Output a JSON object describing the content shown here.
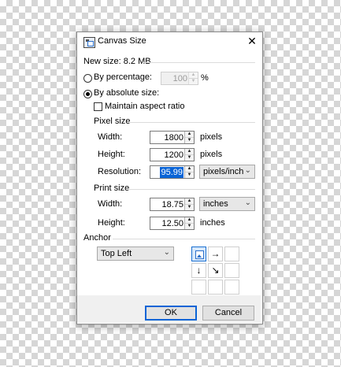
{
  "dialog": {
    "title": "Canvas Size",
    "close_glyph": "✕",
    "new_size": "New size: 8.2 MB",
    "by_percentage_label": "By percentage:",
    "percentage_value": "100",
    "percent_unit": "%",
    "by_absolute_label": "By absolute size:",
    "maintain_aspect_label": "Maintain aspect ratio",
    "pixel_size": {
      "header": "Pixel size",
      "width_label": "Width:",
      "width_value": "1800",
      "width_unit": "pixels",
      "height_label": "Height:",
      "height_value": "1200",
      "height_unit": "pixels",
      "resolution_label": "Resolution:",
      "resolution_value": "95.99",
      "resolution_unit": "pixels/inch"
    },
    "print_size": {
      "header": "Print size",
      "width_label": "Width:",
      "width_value": "18.75",
      "width_unit": "inches",
      "height_label": "Height:",
      "height_value": "12.50",
      "height_unit": "inches"
    },
    "anchor": {
      "header": "Anchor",
      "selected": "Top Left",
      "grid": [
        "",
        "→",
        "",
        "↓",
        "↘",
        "",
        "",
        "",
        ""
      ]
    },
    "ok_label": "OK",
    "cancel_label": "Cancel",
    "radio_selected": "absolute",
    "maintain_aspect_checked": false
  }
}
